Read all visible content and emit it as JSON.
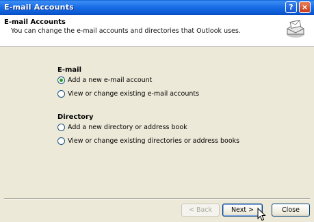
{
  "window": {
    "title": "E-mail Accounts",
    "help_glyph": "?",
    "close_glyph": "×"
  },
  "header": {
    "title": "E-mail Accounts",
    "subtitle": "You can change the e-mail accounts and directories that Outlook uses.",
    "icon": "mailbox-envelope-icon"
  },
  "email_group": {
    "label": "E-mail",
    "options": [
      {
        "label": "Add a new e-mail account",
        "checked": true
      },
      {
        "label": "View or change existing e-mail accounts",
        "checked": false
      }
    ]
  },
  "directory_group": {
    "label": "Directory",
    "options": [
      {
        "label": "Add a new directory or address book",
        "checked": false
      },
      {
        "label": "View or change existing directories or address books",
        "checked": false
      }
    ]
  },
  "buttons": {
    "back": "< Back",
    "next": "Next >",
    "close": "Close"
  },
  "colors": {
    "titlebar": "#0a58d0",
    "dialog_bg": "#ece9d8",
    "radio_check": "#21a121"
  }
}
